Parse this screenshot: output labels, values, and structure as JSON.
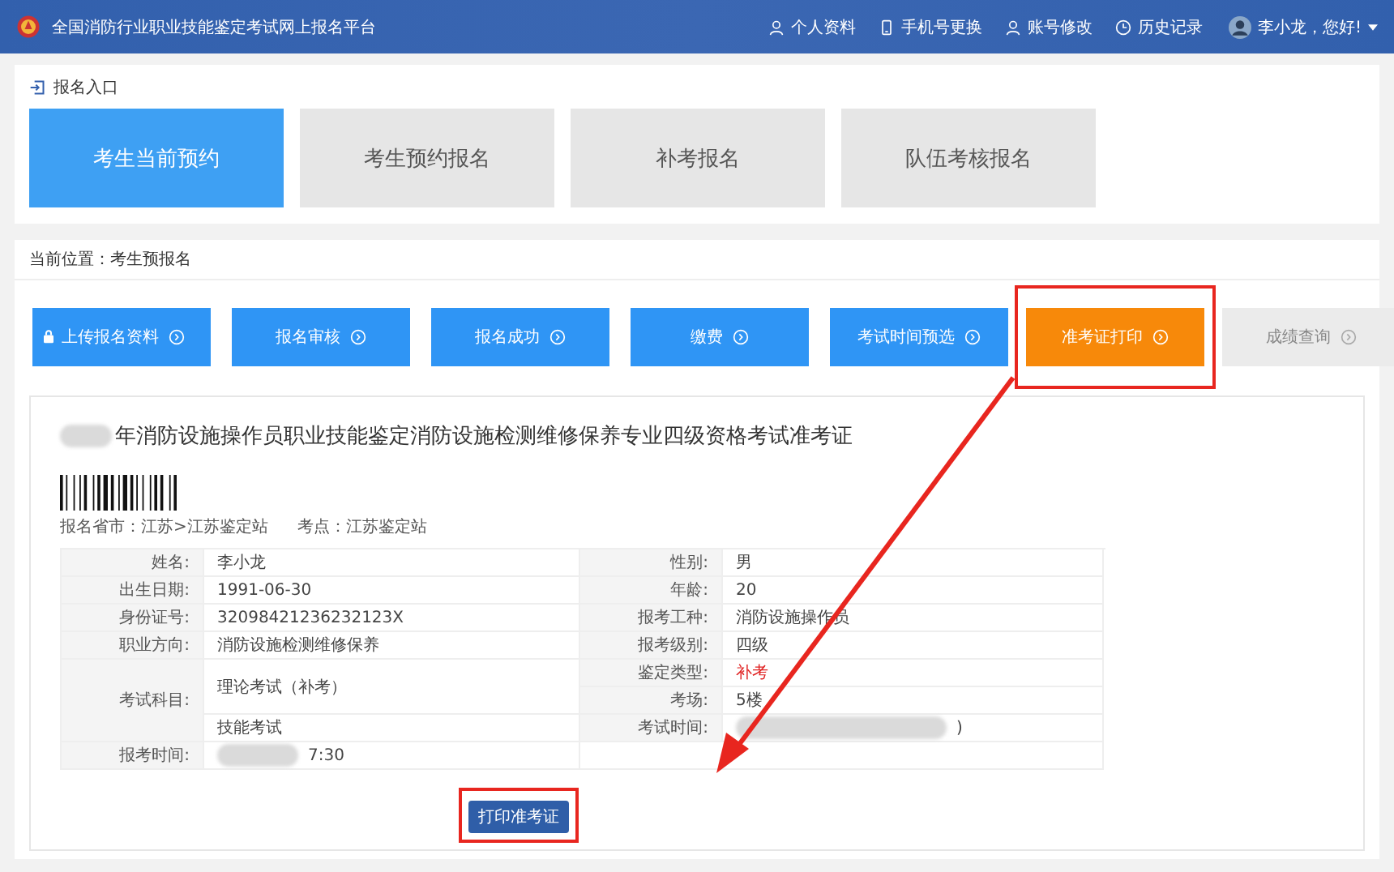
{
  "header": {
    "title": "全国消防行业职业技能鉴定考试网上报名平台",
    "nav": [
      {
        "label": "个人资料",
        "kind": "person"
      },
      {
        "label": "手机号更换",
        "kind": "phone"
      },
      {
        "label": "账号修改",
        "kind": "person"
      },
      {
        "label": "历史记录",
        "kind": "clock"
      }
    ],
    "user": "李小龙，您好!"
  },
  "entry": {
    "title": "报名入口",
    "options": [
      {
        "label": "考生当前预约",
        "selected": true
      },
      {
        "label": "考生预约报名",
        "selected": false
      },
      {
        "label": "补考报名",
        "selected": false
      },
      {
        "label": "队伍考核报名",
        "selected": false
      }
    ]
  },
  "progress": {
    "breadcrumb": "当前位置：考生预报名",
    "steps": [
      {
        "label": "上传报名资料",
        "selected": false,
        "disabled": false,
        "locked": true,
        "annotated": false
      },
      {
        "label": "报名审核",
        "selected": false,
        "disabled": false,
        "locked": false,
        "annotated": false
      },
      {
        "label": "报名成功",
        "selected": false,
        "disabled": false,
        "locked": false,
        "annotated": false
      },
      {
        "label": "缴费",
        "selected": false,
        "disabled": false,
        "locked": false,
        "annotated": false
      },
      {
        "label": "考试时间预选",
        "selected": false,
        "disabled": false,
        "locked": false,
        "annotated": false
      },
      {
        "label": "准考证打印",
        "selected": true,
        "disabled": false,
        "locked": false,
        "annotated": true
      },
      {
        "label": "成绩查询",
        "selected": false,
        "disabled": true,
        "locked": false,
        "annotated": false
      }
    ]
  },
  "ticket": {
    "title": "年消防设施操作员职业技能鉴定消防设施检测维修保养专业四级资格考试准考证",
    "title_redacted": true,
    "province": "报名省市：江苏>江苏鉴定站",
    "site": "考点：江苏鉴定站",
    "left": [
      {
        "label": "姓名:",
        "value": "李小龙",
        "highlight": false
      },
      {
        "label": "出生日期:",
        "value": "1991-06-30",
        "highlight": false
      },
      {
        "label": "身份证号:",
        "value": "32098421236232123X",
        "highlight": false
      },
      {
        "label": "职业方向:",
        "value": "消防设施检测维修保养",
        "highlight": false
      }
    ],
    "subject": {
      "label": "考试科目:",
      "items": [
        "理论考试（补考）",
        "技能考试"
      ]
    },
    "right": [
      {
        "label": "性别:",
        "value": "男",
        "highlight": false
      },
      {
        "label": "年龄:",
        "value": "20",
        "highlight": false
      },
      {
        "label": "报考工种:",
        "value": "消防设施操作员",
        "highlight": false
      },
      {
        "label": "报考级别:",
        "value": "四级",
        "highlight": false
      },
      {
        "label": "鉴定类型:",
        "value": "补考",
        "highlight": true
      },
      {
        "label": "考场:",
        "value": "5楼",
        "highlight": false
      },
      {
        "label": "考试时间:",
        "value": ")",
        "redacted": true,
        "highlight": false
      }
    ],
    "report_time": {
      "label": "报考时间:",
      "value": "7:30",
      "redacted": true
    },
    "print_button": {
      "label": "打印准考证",
      "annotated": true
    }
  }
}
